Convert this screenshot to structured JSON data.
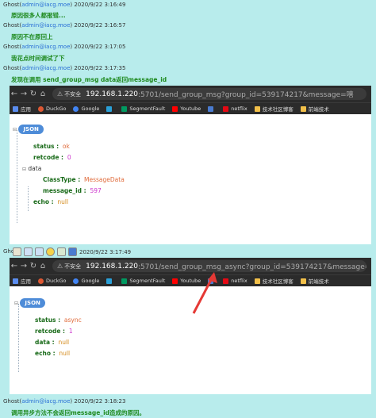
{
  "posts": [
    {
      "author": "Ghost",
      "email": "admin@iacg.moe",
      "time": "2020/9/22 3:16:49",
      "text": "原因很多人都报错..."
    },
    {
      "author": "Ghost",
      "email": "admin@iacg.moe",
      "time": "2020/9/22 3:16:57",
      "text": "原因不在原回上"
    },
    {
      "author": "Ghost",
      "email": "admin@iacg.moe",
      "time": "2020/9/22 3:17:05",
      "text": "我花点时间调试了下"
    },
    {
      "author": "Ghost",
      "email": "admin@iacg.moe",
      "time": "2020/9/22 3:17:35",
      "text": "发现在调用 send_group_msg data返回message_id"
    },
    {
      "author": "Ghost",
      "email": "",
      "time": "2020/9/22 3:17:49",
      "text": ""
    },
    {
      "author": "Ghost",
      "email": "admin@iacg.moe",
      "time": "2020/9/22 3:18:23",
      "text": "调用异步方法不会返回message_id造成的原因。"
    }
  ],
  "browser1": {
    "insecure": "不安全",
    "host": "192.168.1.220",
    "path": ":5701/send_group_msg?group_id=539174217&message=嘻"
  },
  "browser2": {
    "insecure": "不安全",
    "host": "192.168.1.220",
    "path": ":5701/send_group_msg_async?group_id=539174217&message=嘻"
  },
  "bookmarks": [
    {
      "label": "应用",
      "color": "#5b8def"
    },
    {
      "label": "DuckGo",
      "color": "#de5833"
    },
    {
      "label": "Google",
      "color": "#4285f4"
    },
    {
      "label": "",
      "color": "#2aa0d8"
    },
    {
      "label": "SegmentFault",
      "color": "#009a61"
    },
    {
      "label": "Youtube",
      "color": "#ff0000"
    },
    {
      "label": "",
      "color": "#4a7bd0"
    },
    {
      "label": "netflix",
      "color": "#e50914"
    },
    {
      "label": "技术社区博客",
      "color": "#f2c04a"
    },
    {
      "label": "前端技术",
      "color": "#f2c04a"
    }
  ],
  "json1": {
    "badge": "JSON",
    "status_key": "status :",
    "status_val": "ok",
    "retcode_key": "retcode :",
    "retcode_val": "0",
    "data_key": "data",
    "classtype_key": "ClassType :",
    "classtype_val": "MessageData",
    "msgid_key": "message_id :",
    "msgid_val": "597",
    "echo_key": "echo :",
    "echo_val": "null"
  },
  "json2": {
    "badge": "JSON",
    "status_key": "status :",
    "status_val": "async",
    "retcode_key": "retcode :",
    "retcode_val": "1",
    "data_key": "data :",
    "data_val": "null",
    "echo_key": "echo :",
    "echo_val": "null"
  },
  "colors": {
    "accent": "#e53935",
    "background": "#b8ecec",
    "link": "#2a6fd6",
    "message": "#1f8a1f"
  }
}
